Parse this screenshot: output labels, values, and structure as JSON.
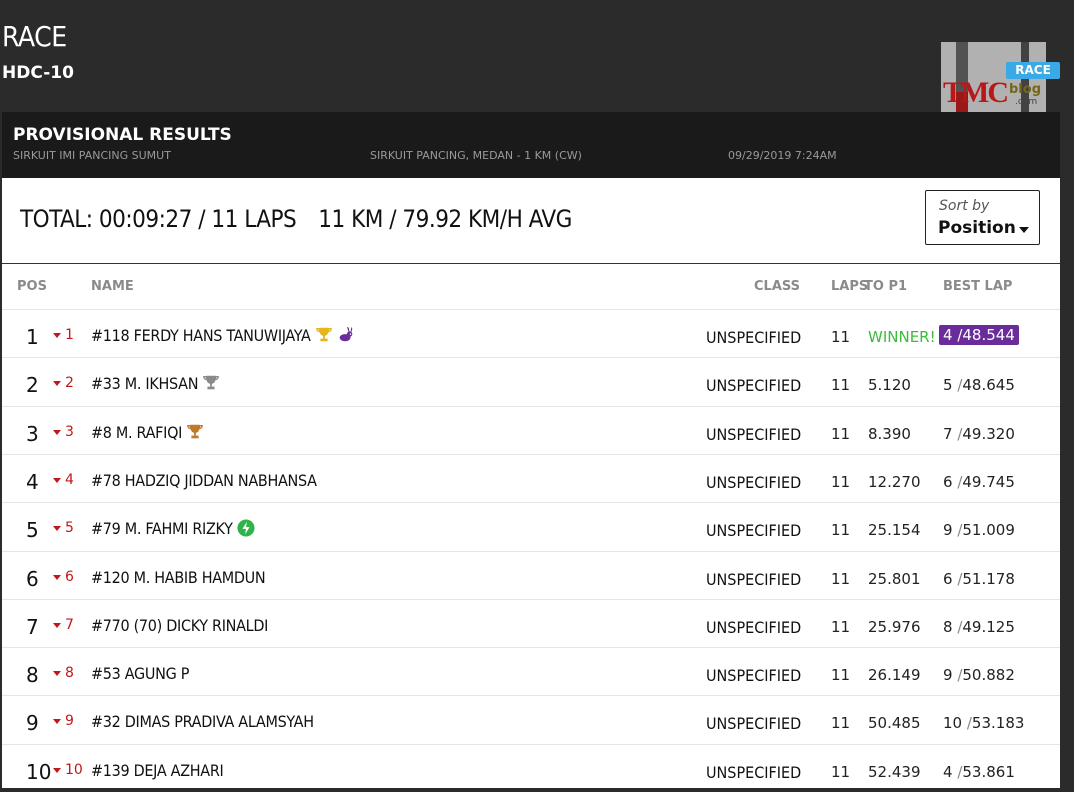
{
  "header": {
    "title": "RACE",
    "subtitle": "HDC-10",
    "badge": "RACE",
    "logo_text": "TMC",
    "logo_blog": "blog",
    "logo_com": ".com"
  },
  "results": {
    "title": "PROVISIONAL RESULTS",
    "event": "SIRKUIT IMI PANCING SUMUT",
    "circuit": "SIRKUIT PANCING, MEDAN - 1 KM (CW)",
    "datetime": "09/29/2019 7:24AM"
  },
  "summary": {
    "total": "TOTAL: 00:09:27 / 11 LAPS",
    "distance": "11 KM / 79.92 KM/H AVG"
  },
  "sort": {
    "label": "Sort by",
    "value": "Position"
  },
  "columns": {
    "pos": "POS",
    "name": "NAME",
    "class": "CLASS",
    "laps": "LAPS",
    "to_p1": "TO P1",
    "best_lap": "BEST LAP"
  },
  "colors": {
    "accent_red": "#c0181a",
    "winner_green": "#3dbb3d",
    "fastest_purple": "#6a2c9a",
    "badge_blue": "#3aa9e6"
  },
  "rows": [
    {
      "pos": "1",
      "change": "1",
      "name": "#118 FERDY HANS TANUWIJAYA",
      "icons": [
        "gold-trophy-icon",
        "rabbit-icon"
      ],
      "class": "UNSPECIFIED",
      "laps": "11",
      "gap": "WINNER!",
      "best_lap_no": "4",
      "best_lap_time": "48.544",
      "fastest": true
    },
    {
      "pos": "2",
      "change": "2",
      "name": "#33 M. IKHSAN",
      "icons": [
        "silver-trophy-icon"
      ],
      "class": "UNSPECIFIED",
      "laps": "11",
      "gap": "5.120",
      "best_lap_no": "5",
      "best_lap_time": "48.645",
      "fastest": false
    },
    {
      "pos": "3",
      "change": "3",
      "name": "#8 M. RAFIQI",
      "icons": [
        "bronze-trophy-icon"
      ],
      "class": "UNSPECIFIED",
      "laps": "11",
      "gap": "8.390",
      "best_lap_no": "7",
      "best_lap_time": "49.320",
      "fastest": false
    },
    {
      "pos": "4",
      "change": "4",
      "name": "#78 HADZIQ JIDDAN NABHANSA",
      "icons": [],
      "class": "UNSPECIFIED",
      "laps": "11",
      "gap": "12.270",
      "best_lap_no": "6",
      "best_lap_time": "49.745",
      "fastest": false
    },
    {
      "pos": "5",
      "change": "5",
      "name": "#79 M. FAHMI RIZKY",
      "icons": [
        "bolt-icon"
      ],
      "class": "UNSPECIFIED",
      "laps": "11",
      "gap": "25.154",
      "best_lap_no": "9",
      "best_lap_time": "51.009",
      "fastest": false
    },
    {
      "pos": "6",
      "change": "6",
      "name": "#120 M. HABIB HAMDUN",
      "icons": [],
      "class": "UNSPECIFIED",
      "laps": "11",
      "gap": "25.801",
      "best_lap_no": "6",
      "best_lap_time": "51.178",
      "fastest": false
    },
    {
      "pos": "7",
      "change": "7",
      "name": "#770 (70) DICKY RINALDI",
      "icons": [],
      "class": "UNSPECIFIED",
      "laps": "11",
      "gap": "25.976",
      "best_lap_no": "8",
      "best_lap_time": "49.125",
      "fastest": false
    },
    {
      "pos": "8",
      "change": "8",
      "name": "#53 AGUNG P",
      "icons": [],
      "class": "UNSPECIFIED",
      "laps": "11",
      "gap": "26.149",
      "best_lap_no": "9",
      "best_lap_time": "50.882",
      "fastest": false
    },
    {
      "pos": "9",
      "change": "9",
      "name": "#32 DIMAS PRADIVA ALAMSYAH",
      "icons": [],
      "class": "UNSPECIFIED",
      "laps": "11",
      "gap": "50.485",
      "best_lap_no": "10",
      "best_lap_time": "53.183",
      "fastest": false
    },
    {
      "pos": "10",
      "change": "10",
      "name": "#139 DEJA AZHARI",
      "icons": [],
      "class": "UNSPECIFIED",
      "laps": "11",
      "gap": "52.439",
      "best_lap_no": "4",
      "best_lap_time": "53.861",
      "fastest": false
    }
  ]
}
